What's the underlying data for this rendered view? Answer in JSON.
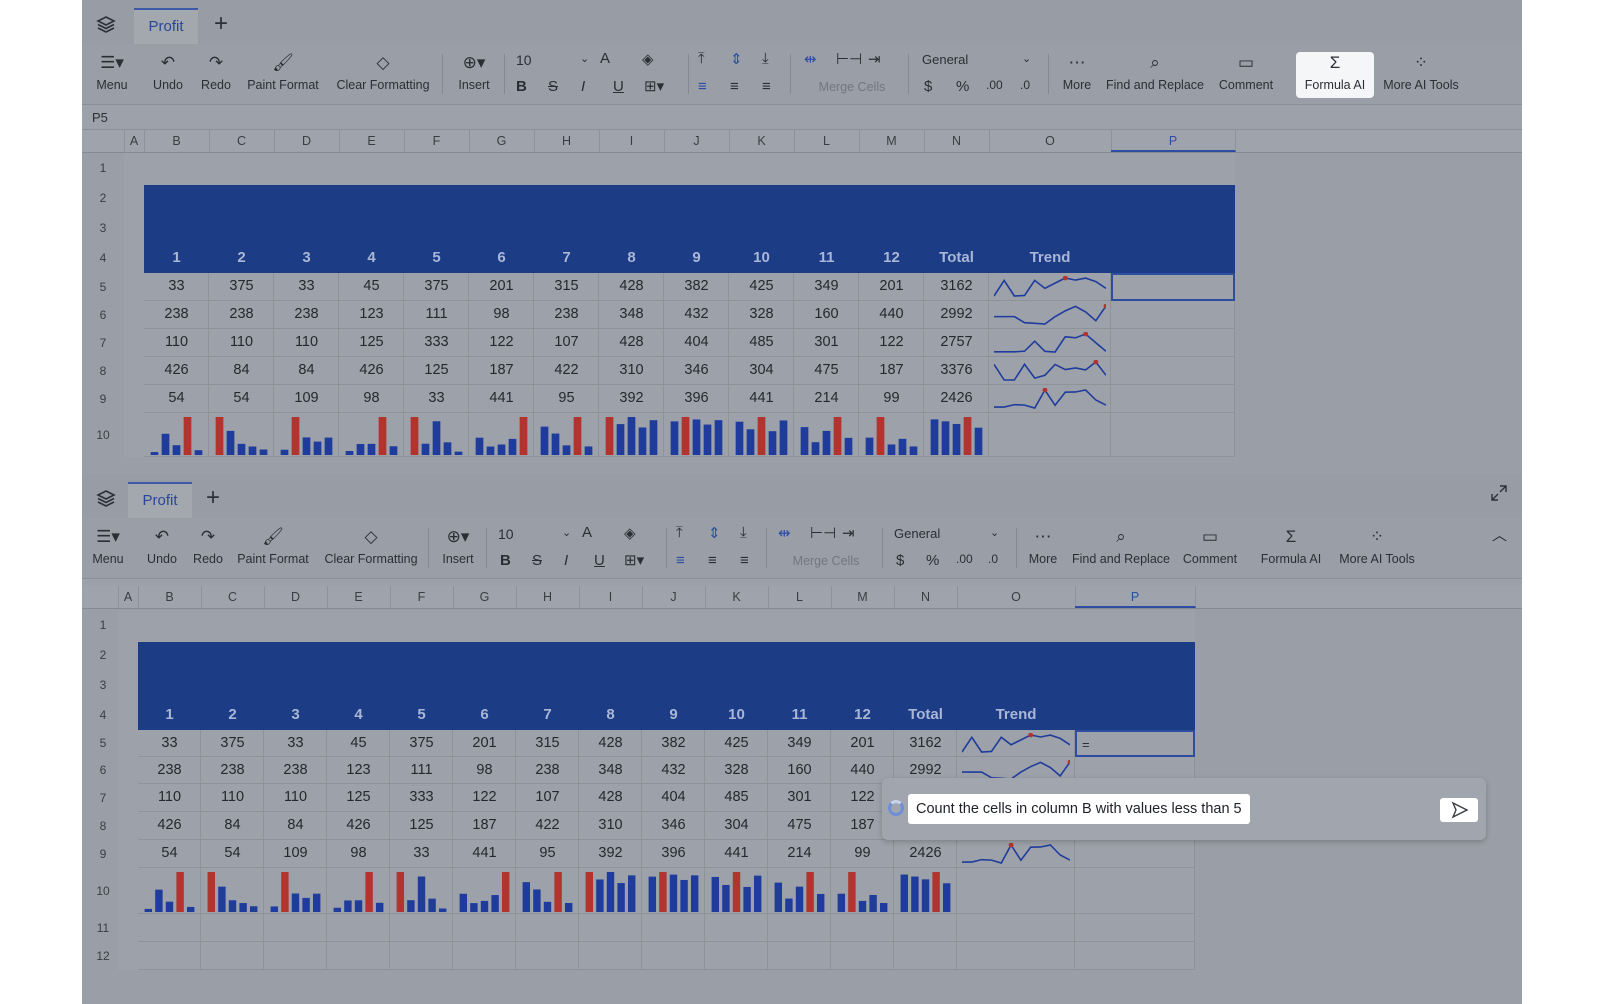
{
  "tab": {
    "name": "Profit"
  },
  "toolbar": {
    "menu": "Menu",
    "undo": "Undo",
    "redo": "Redo",
    "paint_format": "Paint Format",
    "clear_formatting": "Clear Formatting",
    "insert": "Insert",
    "font_size": "10",
    "number_format": "General",
    "merge_cells": "Merge Cells",
    "more": "More",
    "find_replace": "Find and Replace",
    "comment": "Comment",
    "formula_ai": "Formula AI",
    "more_ai_tools": "More AI Tools",
    "dollar": "$",
    "percent": "%"
  },
  "formula_bar": {
    "cell_ref": "P5",
    "content": "="
  },
  "columns": [
    "A",
    "B",
    "C",
    "D",
    "E",
    "F",
    "G",
    "H",
    "I",
    "J",
    "K",
    "L",
    "M",
    "N",
    "O",
    "P"
  ],
  "rows_top": [
    "1",
    "2",
    "3",
    "4",
    "5",
    "6",
    "7",
    "8",
    "9",
    "10"
  ],
  "rows_bottom": [
    "1",
    "2",
    "3",
    "4",
    "5",
    "6",
    "7",
    "8",
    "9",
    "10",
    "11",
    "12"
  ],
  "table": {
    "headers": [
      "1",
      "2",
      "3",
      "4",
      "5",
      "6",
      "7",
      "8",
      "9",
      "10",
      "11",
      "12",
      "Total",
      "Trend"
    ],
    "rows": [
      [
        "33",
        "375",
        "33",
        "45",
        "375",
        "201",
        "315",
        "428",
        "382",
        "425",
        "349",
        "201",
        "3162"
      ],
      [
        "238",
        "238",
        "238",
        "123",
        "111",
        "98",
        "238",
        "348",
        "432",
        "328",
        "160",
        "440",
        "2992"
      ],
      [
        "110",
        "110",
        "110",
        "125",
        "333",
        "122",
        "107",
        "428",
        "404",
        "485",
        "301",
        "122",
        "2757"
      ],
      [
        "426",
        "84",
        "84",
        "426",
        "125",
        "187",
        "422",
        "310",
        "346",
        "304",
        "475",
        "187",
        "3376"
      ],
      [
        "54",
        "54",
        "109",
        "98",
        "33",
        "441",
        "95",
        "392",
        "396",
        "441",
        "214",
        "99",
        "2426"
      ]
    ]
  },
  "active_cell_value": "=",
  "ai_prompt": {
    "text": "Count the cells in column B with values less than 5"
  },
  "colors": {
    "header_band": "#1c3c85",
    "bar_normal": "#1f3c9c",
    "bar_max": "#b3342e",
    "accent": "#2d4da0"
  }
}
